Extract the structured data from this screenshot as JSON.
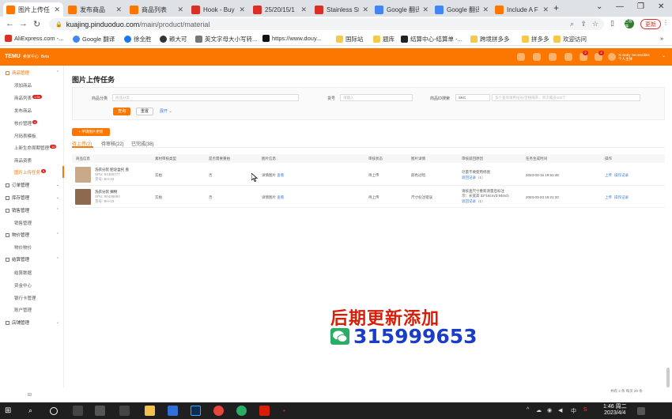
{
  "browser": {
    "tabs": [
      {
        "label": "图片上传任",
        "active": true,
        "icon_color": "#fb7701"
      },
      {
        "label": "发布商品",
        "icon_color": "#fb7701"
      },
      {
        "label": "商品列表",
        "icon_color": "#fb7701"
      },
      {
        "label": "Hook - Buy",
        "icon_color": "#d93025"
      },
      {
        "label": "25/20/15/1",
        "icon_color": "#d93025"
      },
      {
        "label": "Stainless St",
        "icon_color": "#d93025"
      },
      {
        "label": "Google 翻译",
        "icon_color": "#4285f4"
      },
      {
        "label": "Google 翻译",
        "icon_color": "#4285f4"
      },
      {
        "label": "Include A F",
        "icon_color": "#fb7701"
      }
    ],
    "new_tab": "+",
    "url_host": "kuajing.pinduoduo.com",
    "url_path": "/main/product/material",
    "profile": "已暂停",
    "update_label": "更新",
    "bookmarks": [
      "AliExpress.com -...",
      "Google 翻译",
      "徐全胜",
      "赖大可",
      "英文字母大小写转...",
      "https://www.douy...",
      "国际站",
      "题库",
      "结算中心-结算单 -...",
      "跨境拼多多",
      "拼多多",
      "欢迎访问"
    ]
  },
  "app": {
    "logo": "TEMU",
    "logo_sub": "卖家中心",
    "logo_beta": "Beta",
    "user_name": "Xi Baby Necessities",
    "user_role": "个人主体",
    "header_badges": [
      "2",
      "4"
    ]
  },
  "sidebar": {
    "groups": [
      {
        "label": "商品管理",
        "expanded": true,
        "items": [
          {
            "label": "添加商品"
          },
          {
            "label": "商品列表",
            "badge": "1.5k"
          },
          {
            "label": "发布商品"
          },
          {
            "label": "核价管理",
            "badge": "4"
          },
          {
            "label": "尺码表模板"
          },
          {
            "label": "上新生命周期管理",
            "badge": "10"
          },
          {
            "label": "商品资质"
          },
          {
            "label": "图片上传任务",
            "badge": "5",
            "active": true
          }
        ]
      },
      {
        "label": "订单管理",
        "expanded": false
      },
      {
        "label": "库存管理",
        "expanded": false
      },
      {
        "label": "销售管理",
        "expanded": true,
        "items": [
          {
            "label": "销售管理"
          }
        ]
      },
      {
        "label": "物价管理",
        "expanded": true,
        "items": [
          {
            "label": "物价物价"
          }
        ]
      },
      {
        "label": "结算管理",
        "expanded": true,
        "items": [
          {
            "label": "结算数据"
          },
          {
            "label": "资金中心"
          },
          {
            "label": "银行卡管理"
          },
          {
            "label": "账户管理"
          }
        ]
      },
      {
        "label": "店铺管理",
        "expanded": false
      }
    ],
    "collapse_icon": "collapse-icon"
  },
  "main": {
    "title": "图片上传任务",
    "filters": {
      "product_category_label": "商品分类",
      "product_category_placeholder": "商品分类",
      "sku_label": "货号",
      "sku_placeholder": "请输入",
      "product_id_label": "商品ID搜索",
      "product_id_select": "SKC",
      "product_id_placeholder": "多个查询请用逗号/空格隔开，单次最多100个"
    },
    "query_label": "查询",
    "reset_label": "重置",
    "expand_label": "展开",
    "upload_btn": "+ 申请图片更新",
    "status_tabs": [
      {
        "label": "待上传(2)",
        "active": true
      },
      {
        "label": "待审核(22)"
      },
      {
        "label": "已完成(38)"
      }
    ],
    "table": {
      "headers": [
        "商品信息",
        "素材审核类型",
        "是否需要重拍",
        "图片信息",
        "审核状态",
        "图片详情",
        "审核驳回原因",
        "任务生成时间",
        "操作"
      ],
      "rows": [
        {
          "name": "洗衣分装 肥皂盒托 盘",
          "spu": "SPU: 94385777",
          "sku": "货号: BH-43",
          "type": "实拍",
          "reshoot": "否",
          "image_info": "详情图片",
          "view": "查看",
          "status": "待上传",
          "detail": "颜色过暗",
          "reason": "尽量不要使用修图",
          "reason_link": "驳回记录（1）",
          "time": "2023-03-15 19:51:48",
          "actions": [
            "上传",
            "操作记录"
          ],
          "thumb_color": "#c9a98a"
        },
        {
          "name": "洗衣分装 搁物",
          "spu": "SPU: 90438694",
          "sku": "货号: BH-15",
          "type": "实拍",
          "reshoot": "否",
          "image_info": "详情图片",
          "view": "查看",
          "status": "待上传",
          "detail": "尺寸标注错误",
          "reason": "请核查尺寸重新测量后标注",
          "reason_2": "示：长宽高 32*16cm/3.94inch",
          "reason_link": "驳回记录（1）",
          "time": "2023-03-23 15:21:33",
          "actions": [
            "上传",
            "操作记录"
          ],
          "thumb_color": "#8d6a4f"
        }
      ]
    },
    "pagination": "共有 2 条  每页  20  条"
  },
  "overlay": {
    "line1": "后期更新添加",
    "line2": "315999653",
    "red": "#d81e06",
    "blue": "#1a3dc9"
  },
  "taskbar": {
    "time": "1:46 周二",
    "date": "2023/4/4",
    "tray": [
      "^",
      "中",
      "S"
    ]
  }
}
